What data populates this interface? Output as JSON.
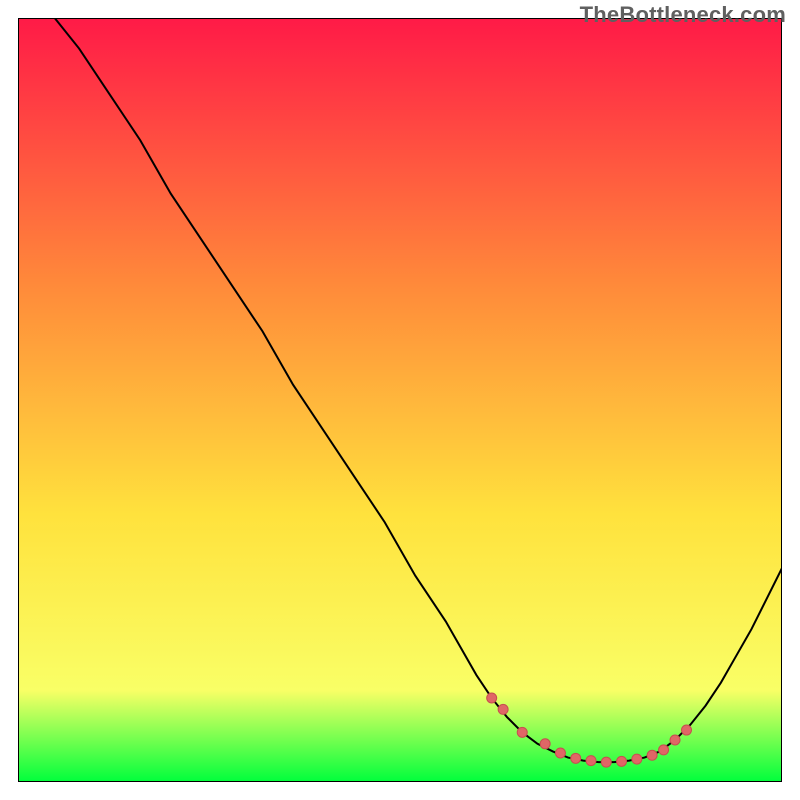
{
  "watermark": {
    "text": "TheBottleneck.com"
  },
  "colors": {
    "gradient_top": "#ff1a47",
    "gradient_upper_mid": "#ff8a3a",
    "gradient_mid": "#ffe23d",
    "gradient_lower_mid": "#f9ff66",
    "gradient_bottom": "#00ff3c",
    "border": "#000000",
    "curve": "#000000",
    "dot_fill": "#e06666",
    "dot_stroke": "#c74f4f"
  },
  "chart_data": {
    "type": "line",
    "title": "",
    "xlabel": "",
    "ylabel": "",
    "xlim": [
      0,
      100
    ],
    "ylim": [
      0,
      100
    ],
    "series": [
      {
        "name": "bottleneck-curve",
        "x": [
          0,
          4,
          8,
          12,
          16,
          20,
          24,
          28,
          32,
          36,
          40,
          44,
          48,
          52,
          56,
          60,
          62,
          64,
          66,
          68,
          70,
          72,
          74,
          76,
          78,
          80,
          82,
          84,
          86,
          88,
          90,
          92,
          94,
          96,
          98,
          100
        ],
        "y": [
          107,
          101,
          96,
          90,
          84,
          77,
          71,
          65,
          59,
          52,
          46,
          40,
          34,
          27,
          21,
          14,
          11,
          8.5,
          6.5,
          5,
          4,
          3.2,
          2.8,
          2.6,
          2.6,
          2.8,
          3.2,
          4,
          5.5,
          7.5,
          10,
          13,
          16.5,
          20,
          24,
          28
        ]
      }
    ],
    "optimal_points": {
      "name": "optimal-range-dots",
      "x": [
        62,
        63.5,
        66,
        69,
        71,
        73,
        75,
        77,
        79,
        81,
        83,
        84.5,
        86,
        87.5
      ],
      "y": [
        11,
        9.5,
        6.5,
        5,
        3.8,
        3.1,
        2.8,
        2.6,
        2.7,
        3,
        3.5,
        4.2,
        5.5,
        6.8
      ]
    }
  }
}
